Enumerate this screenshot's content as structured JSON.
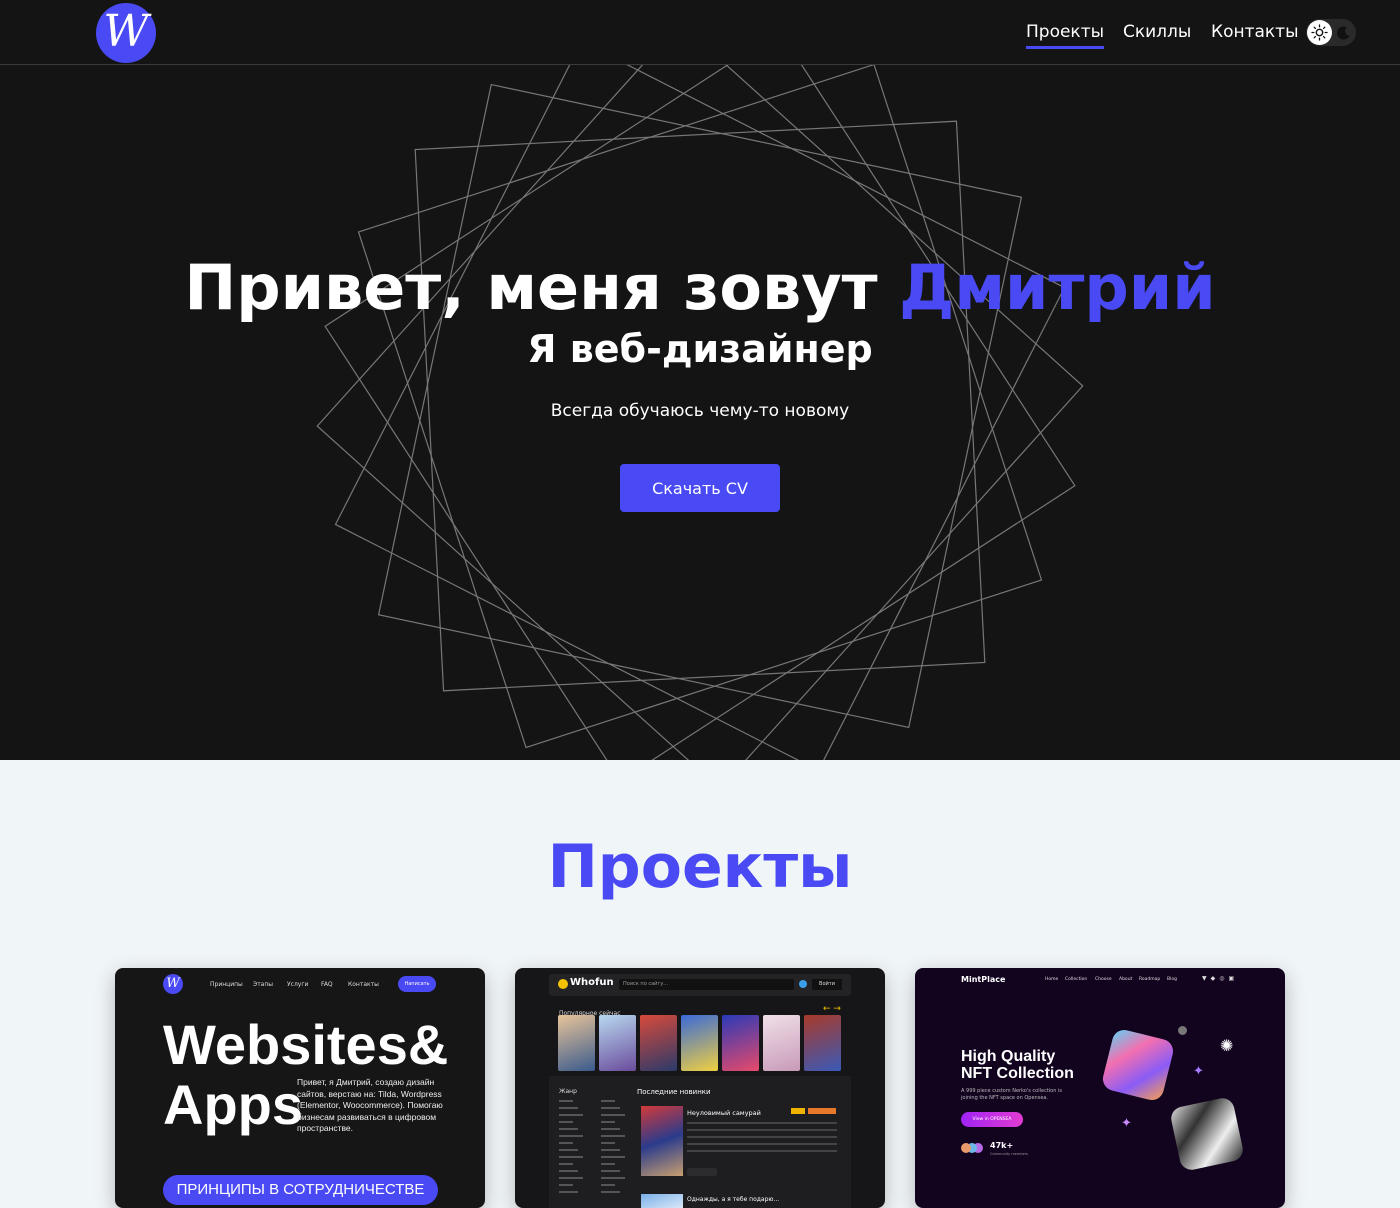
{
  "header": {
    "logo_letter": "W",
    "nav": [
      {
        "label": "Проекты",
        "active": true
      },
      {
        "label": "Скиллы",
        "active": false
      },
      {
        "label": "Контакты",
        "active": false
      }
    ],
    "theme_toggle": {
      "sun_icon": "sun-icon",
      "moon_icon": "moon-icon"
    }
  },
  "hero": {
    "title_prefix": "Привет, меня зовут ",
    "title_name": "Дмитрий",
    "subtitle": "Я веб-дизайнер",
    "tagline": "Всегда обучаюсь чему-то новому",
    "cv_button": "Скачать CV"
  },
  "projects": {
    "title": "Проекты",
    "cards": [
      {
        "nav_links": [
          "Принципы",
          "Этапы",
          "Услуги",
          "FAQ",
          "Контакты"
        ],
        "nav_button": "Написать",
        "headline_1": "Websites&",
        "headline_2": "Apps",
        "description": "Привет, я Дмитрий, создаю дизайн сайтов, верстаю на: Tilda, Wordpress (Elementor, Woocommerce). Помогаю бизнесам развиваться в цифровом пространстве.",
        "banner": "ПРИНЦИПЫ В СОТРУДНИЧЕСТВЕ"
      },
      {
        "brand": "Whofun",
        "search_placeholder": "Поиск по сайту...",
        "login": "Войти",
        "popular": "Популярное сейчас",
        "menu_heading": "Жанр",
        "latest": "Последние новинки",
        "item_title": "Неуловимый самурай",
        "item2_title": "Однажды, а я тебе подарю..."
      },
      {
        "brand": "MintPlace",
        "nav_links": [
          "Home",
          "Collection",
          "Choose",
          "About",
          "Roadmap",
          "Blog"
        ],
        "headline_1": "High Quality",
        "headline_2": "NFT Collection",
        "description": "A 999 piece custom Nerko's collection is joining the NFT space on Opensea.",
        "button": "View in OPENSEA",
        "stat": "47k+",
        "stat_label": "Community members"
      }
    ]
  },
  "colors": {
    "accent": "#4a4af4",
    "dark_bg": "#141414",
    "light_bg": "#f0f5f8"
  }
}
